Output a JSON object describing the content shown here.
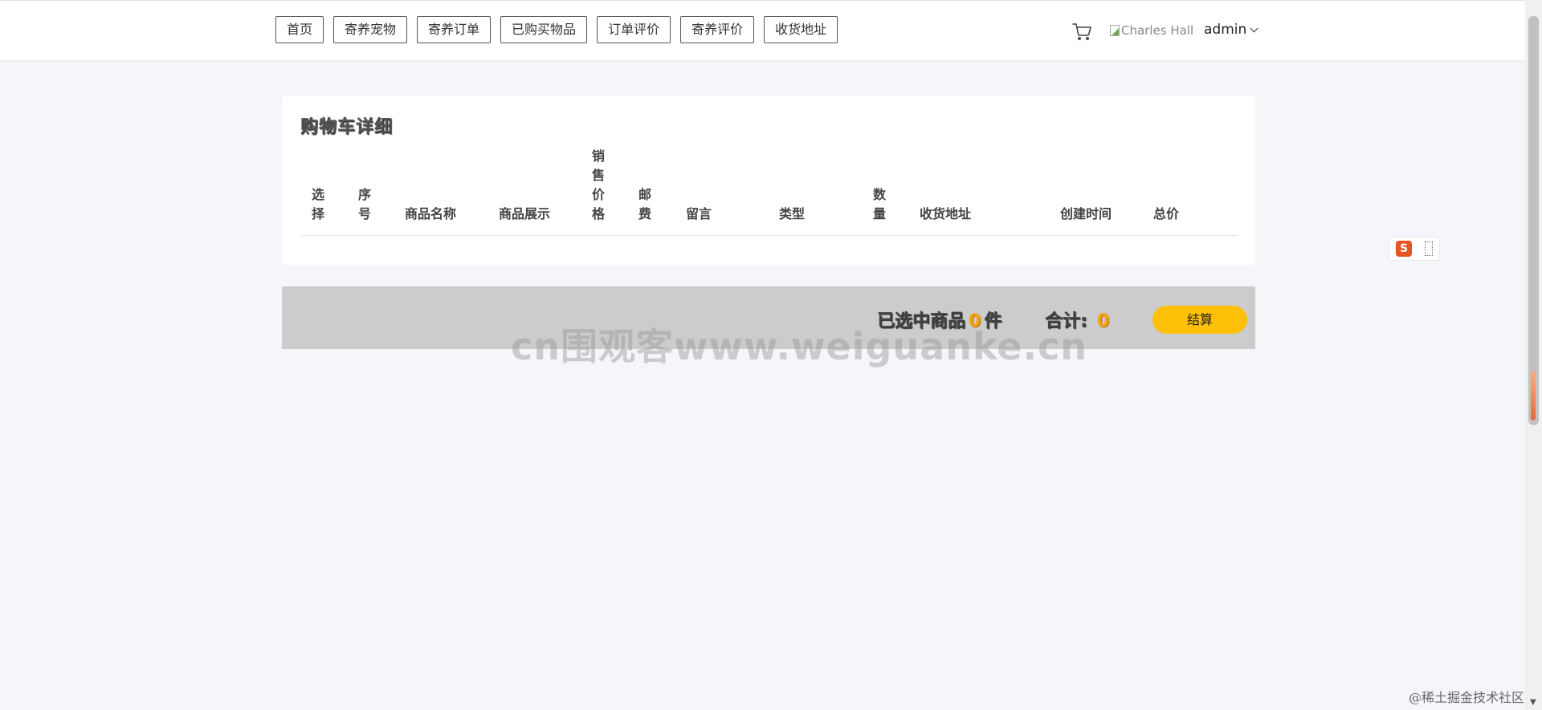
{
  "nav": {
    "items": [
      "首页",
      "寄养宠物",
      "寄养订单",
      "已购买物品",
      "订单评价",
      "寄养评价",
      "收货地址"
    ]
  },
  "header": {
    "avatar_alt": "Charles Hall",
    "username": "admin"
  },
  "cart": {
    "title": "购物车详细",
    "columns": [
      "选择",
      "序号",
      "商品名称",
      "商品展示",
      "销售价格",
      "邮费",
      "留言",
      "类型",
      "数量",
      "收货地址",
      "创建时间",
      "总价"
    ],
    "rows": []
  },
  "summary": {
    "selected_prefix": "已选中商品",
    "selected_count": "0",
    "selected_suffix": "件",
    "total_label": "合计:",
    "total_value": "0",
    "checkout_label": "结算"
  },
  "watermark": "cn围观客www.weiguanke.cn",
  "widget": {
    "logo": "S"
  },
  "footer": {
    "credit": "@稀土掘金技术社区"
  },
  "colors": {
    "accent": "#ffc107",
    "count": "#f7a300",
    "summary_bg": "#cccccc",
    "page_bg": "#f5f6fa"
  }
}
